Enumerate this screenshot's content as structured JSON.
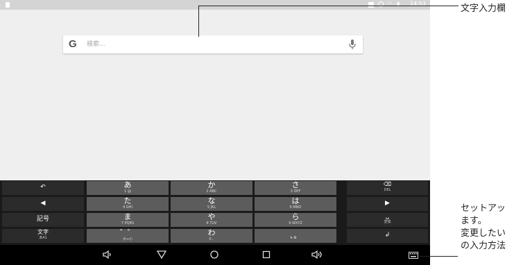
{
  "status_bar": {
    "time": "14:53"
  },
  "search": {
    "logo": "G",
    "placeholder": "検索..."
  },
  "keyboard": {
    "rows": [
      {
        "left": {
          "icon": "undo-icon",
          "glyph": "↶"
        },
        "keys": [
          {
            "kana": "あ",
            "sub": "1    @"
          },
          {
            "kana": "か",
            "sub": "2    ABC"
          },
          {
            "kana": "さ",
            "sub": "3    DEF"
          }
        ],
        "right": {
          "icon": "backspace-icon",
          "glyph": "⌫",
          "sub": "DEL"
        }
      },
      {
        "left": {
          "icon": "cursor-left-icon",
          "glyph": "◀"
        },
        "keys": [
          {
            "kana": "た",
            "sub": "4    GHI"
          },
          {
            "kana": "な",
            "sub": "5    JKL"
          },
          {
            "kana": "は",
            "sub": "6    MNO"
          }
        ],
        "right": {
          "icon": "cursor-right-icon",
          "glyph": "▶"
        }
      },
      {
        "left": {
          "label": "記号"
        },
        "keys": [
          {
            "kana": "ま",
            "sub": "7    PQRS"
          },
          {
            "kana": "や",
            "sub": "8    TUV"
          },
          {
            "kana": "ら",
            "sub": "9    WXYZ"
          }
        ],
        "right": {
          "icon": "space-icon",
          "glyph": "␣",
          "sub": "変換"
        }
      },
      {
        "left": {
          "label": "文字",
          "sub": "あA1"
        },
        "keys": [
          {
            "kana": "゛゜",
            "sub": "大⇔小"
          },
          {
            "kana": "わ",
            "sub": "0    ､"
          },
          {
            "kana": "、。",
            "sub": ""
          }
        ],
        "right": {
          "icon": "enter-icon",
          "glyph": "↲"
        }
      }
    ]
  },
  "nav": {
    "icons": [
      "volume-down-icon",
      "back-icon",
      "home-icon",
      "recents-icon",
      "volume-up-icon",
      "keyboard-icon"
    ]
  },
  "annotations": {
    "top": "文字入力欄",
    "bottom_lines": [
      "セットアッ",
      "ます。",
      "変更したい",
      "の入力方法"
    ]
  }
}
